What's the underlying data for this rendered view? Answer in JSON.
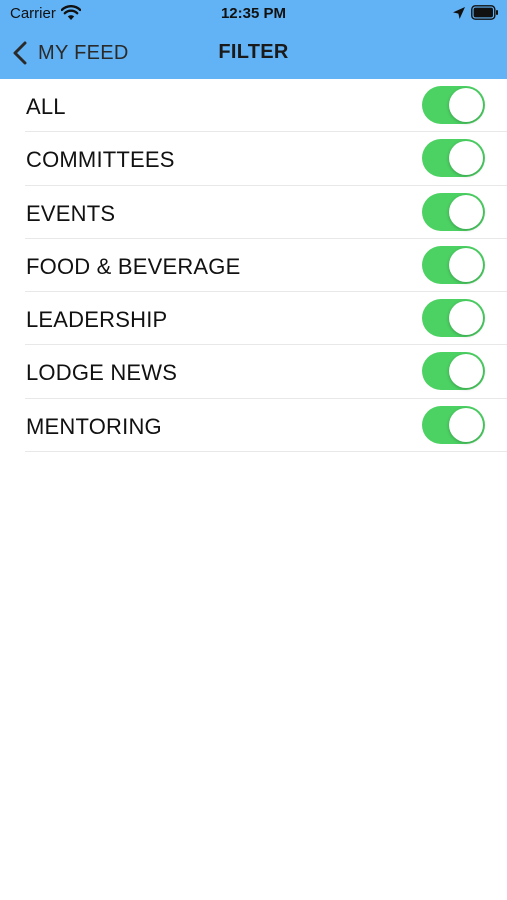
{
  "status_bar": {
    "carrier": "Carrier",
    "time": "12:35 PM",
    "icons": [
      "wifi-icon",
      "location-arrow-icon",
      "battery-icon"
    ]
  },
  "nav": {
    "back_label": "MY FEED",
    "title": "FILTER",
    "back_icon": "chevron-left-icon"
  },
  "colors": {
    "header_bg": "#62b3f5",
    "toggle_on": "#4cd163",
    "separator": "#e8e8e8"
  },
  "filters": [
    {
      "label": "ALL",
      "enabled": true
    },
    {
      "label": "COMMITTEES",
      "enabled": true
    },
    {
      "label": "EVENTS",
      "enabled": true
    },
    {
      "label": "FOOD & BEVERAGE",
      "enabled": true
    },
    {
      "label": "LEADERSHIP",
      "enabled": true
    },
    {
      "label": "LODGE NEWS",
      "enabled": true
    },
    {
      "label": "MENTORING",
      "enabled": true
    }
  ]
}
